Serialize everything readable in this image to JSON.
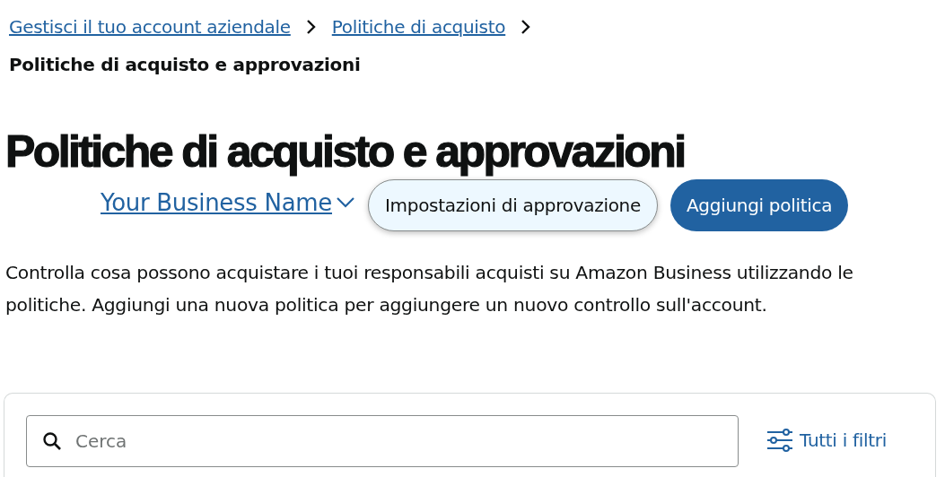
{
  "breadcrumb": [
    {
      "label": "Gestisci il tuo account aziendale"
    },
    {
      "label": "Politiche di acquisto"
    }
  ],
  "current_page": "Politiche di acquisto e approvazioni",
  "title": "Politiche di acquisto e approvazioni",
  "account_selector": "Your Business Name",
  "buttons": [
    {
      "label": "Impostazioni di approvazione",
      "kind": "secondary"
    },
    {
      "label": "Aggiungi politica",
      "kind": "primary"
    }
  ],
  "description": "Controlla cosa possono acquistare i tuoi responsabili acquisti su Amazon Business utilizzando le politiche. Aggiungi una nuova politica per aggiungere un nuovo controllo sull'account.",
  "search": {
    "placeholder": "Cerca"
  },
  "filters_link": "Tutti i filtri"
}
